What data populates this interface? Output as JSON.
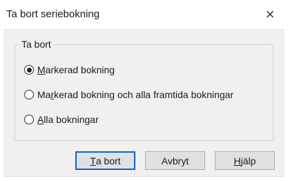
{
  "dialog": {
    "title": "Ta bort seriebokning",
    "close_glyph": "×"
  },
  "group": {
    "legend": "Ta bort",
    "options": [
      {
        "pre": "",
        "mn": "M",
        "post": "arkerad bokning",
        "selected": true
      },
      {
        "pre": "Ma",
        "mn": "r",
        "post": "kerad bokning och alla framtida bokningar",
        "selected": false
      },
      {
        "pre": "",
        "mn": "A",
        "post": "lla bokningar",
        "selected": false
      }
    ]
  },
  "buttons": {
    "delete": {
      "pre": "",
      "mn": "T",
      "post": "a bort"
    },
    "cancel": {
      "label": "Avbryt"
    },
    "help": {
      "pre": "",
      "mn": "H",
      "post": "jälp"
    }
  }
}
